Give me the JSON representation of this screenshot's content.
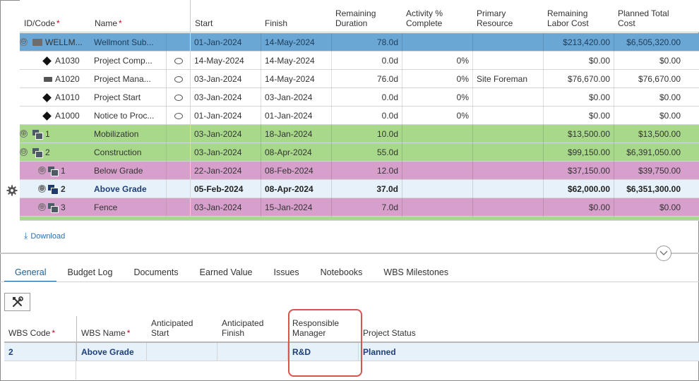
{
  "grid": {
    "columns": {
      "id": "ID/Code",
      "name": "Name",
      "start": "Start",
      "finish": "Finish",
      "remaining_duration": "Remaining Duration",
      "activity_pct": "Activity % Complete",
      "primary_resource": "Primary Resource",
      "remaining_labor_cost": "Remaining Labor Cost",
      "planned_total_cost": "Planned Total Cost",
      "required_mark": "*"
    },
    "rows": [
      {
        "id": "WELLM...",
        "name": "Wellmont Sub...",
        "start": "01-Jan-2024",
        "finish": "14-May-2024",
        "rem": "78.0d",
        "pct": "",
        "res": "",
        "labor": "$213,420.00",
        "total": "$6,505,320.00",
        "style": "blue",
        "icon": "folder-icon",
        "toggle": "⊖"
      },
      {
        "id": "A1030",
        "name": "Project Comp...",
        "start": "14-May-2024",
        "finish": "14-May-2024",
        "rem": "0.0d",
        "pct": "0%",
        "res": "",
        "labor": "$0.00",
        "total": "$0.00",
        "style": "white",
        "icon": "milestone-icon"
      },
      {
        "id": "A1020",
        "name": "Project Mana...",
        "start": "03-Jan-2024",
        "finish": "14-May-2024",
        "rem": "76.0d",
        "pct": "0%",
        "res": "Site Foreman",
        "labor": "$76,670.00",
        "total": "$76,670.00",
        "style": "white",
        "icon": "level-of-effort-icon"
      },
      {
        "id": "A1010",
        "name": "Project Start",
        "start": "03-Jan-2024",
        "finish": "03-Jan-2024",
        "rem": "0.0d",
        "pct": "0%",
        "res": "",
        "labor": "$0.00",
        "total": "$0.00",
        "style": "white",
        "icon": "milestone-icon"
      },
      {
        "id": "A1000",
        "name": "Notice to Proc...",
        "start": "01-Jan-2024",
        "finish": "01-Jan-2024",
        "rem": "0.0d",
        "pct": "0%",
        "res": "",
        "labor": "$0.00",
        "total": "$0.00",
        "style": "white",
        "icon": "milestone-icon"
      },
      {
        "id": "1",
        "name": "Mobilization",
        "start": "03-Jan-2024",
        "finish": "18-Jan-2024",
        "rem": "10.0d",
        "pct": "",
        "res": "",
        "labor": "$13,500.00",
        "total": "$13,500.00",
        "style": "green",
        "icon": "wbs-icon",
        "toggle": "⊕"
      },
      {
        "id": "2",
        "name": "Construction",
        "start": "03-Jan-2024",
        "finish": "08-Apr-2024",
        "rem": "55.0d",
        "pct": "",
        "res": "",
        "labor": "$99,150.00",
        "total": "$6,391,050.00",
        "style": "green",
        "icon": "wbs-icon",
        "toggle": "⊖"
      },
      {
        "id": "1",
        "name": "Below Grade",
        "start": "22-Jan-2024",
        "finish": "08-Feb-2024",
        "rem": "12.0d",
        "pct": "",
        "res": "",
        "labor": "$37,150.00",
        "total": "$39,750.00",
        "style": "pink",
        "icon": "wbs-icon",
        "toggle": "⊕"
      },
      {
        "id": "2",
        "name": "Above Grade",
        "start": "05-Feb-2024",
        "finish": "08-Apr-2024",
        "rem": "37.0d",
        "pct": "",
        "res": "",
        "labor": "$62,000.00",
        "total": "$6,351,300.00",
        "style": "sel",
        "icon": "wbs-icon",
        "toggle": "⊕"
      },
      {
        "id": "3",
        "name": "Fence",
        "start": "03-Jan-2024",
        "finish": "15-Jan-2024",
        "rem": "7.0d",
        "pct": "",
        "res": "",
        "labor": "$0.00",
        "total": "$0.00",
        "style": "pink",
        "icon": "wbs-icon",
        "toggle": "⊕"
      }
    ],
    "download_label": "Download"
  },
  "tabs": [
    {
      "label": "General",
      "active": true
    },
    {
      "label": "Budget Log"
    },
    {
      "label": "Documents"
    },
    {
      "label": "Earned Value"
    },
    {
      "label": "Issues"
    },
    {
      "label": "Notebooks"
    },
    {
      "label": "WBS Milestones"
    }
  ],
  "details": {
    "columns": {
      "wbs_code": "WBS Code",
      "wbs_name": "WBS Name",
      "anticipated_start": "Anticipated Start",
      "anticipated_finish": "Anticipated Finish",
      "responsible_manager": "Responsible Manager",
      "project_status": "Project Status",
      "required_mark": "*"
    },
    "row": {
      "wbs_code": "2",
      "wbs_name": "Above Grade",
      "anticipated_start": "",
      "anticipated_finish": "",
      "responsible_manager": "R&D",
      "project_status": "Planned"
    }
  },
  "colors": {
    "project_row": "#6aa7d4",
    "wbs_level1": "#a8d98b",
    "wbs_level2": "#d7a0cc",
    "selected_row": "#e6f1fa",
    "accent": "#1d5f99",
    "highlight_border": "#d9534f"
  }
}
